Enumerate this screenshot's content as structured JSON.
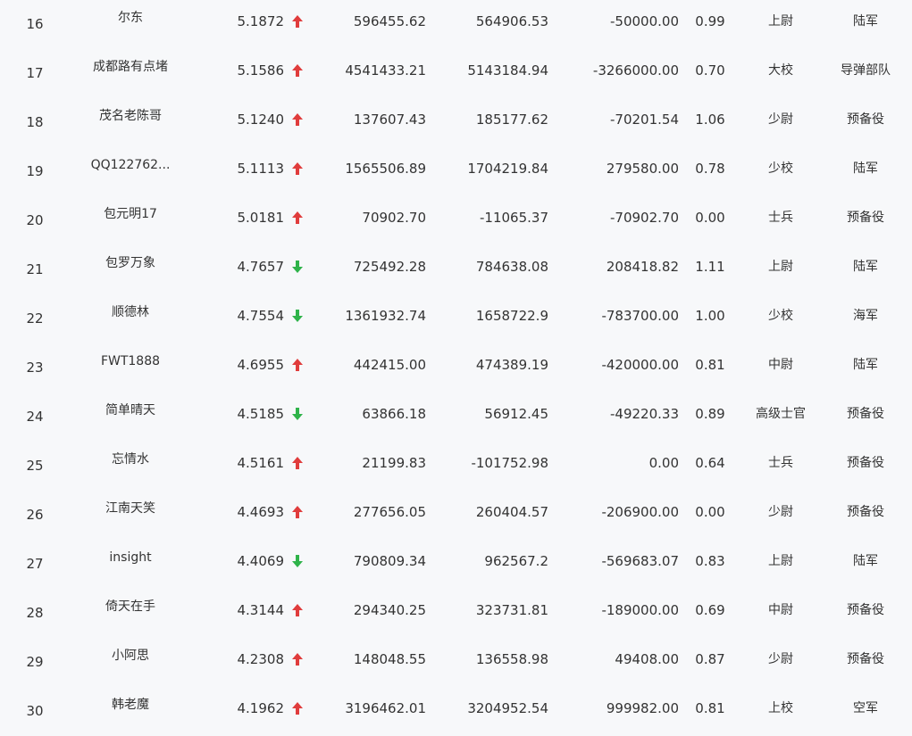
{
  "colors": {
    "up": "#e03c3c",
    "down": "#2fb34a",
    "text": "#333333",
    "background": "#f7f8fa"
  },
  "rows": [
    {
      "rank": "16",
      "name": "尔东",
      "score": "5.1872",
      "trend": "up",
      "v1": "596455.62",
      "v2": "564906.53",
      "v3": "-50000.00",
      "ratio": "0.99",
      "rank_title": "上尉",
      "branch": "陆军"
    },
    {
      "rank": "17",
      "name": "成都路有点堵",
      "score": "5.1586",
      "trend": "up",
      "v1": "4541433.21",
      "v2": "5143184.94",
      "v3": "-3266000.00",
      "ratio": "0.70",
      "rank_title": "大校",
      "branch": "导弹部队"
    },
    {
      "rank": "18",
      "name": "茂名老陈哥",
      "score": "5.1240",
      "trend": "up",
      "v1": "137607.43",
      "v2": "185177.62",
      "v3": "-70201.54",
      "ratio": "1.06",
      "rank_title": "少尉",
      "branch": "预备役"
    },
    {
      "rank": "19",
      "name": "QQ122762...",
      "score": "5.1113",
      "trend": "up",
      "v1": "1565506.89",
      "v2": "1704219.84",
      "v3": "279580.00",
      "ratio": "0.78",
      "rank_title": "少校",
      "branch": "陆军"
    },
    {
      "rank": "20",
      "name": "包元明17",
      "score": "5.0181",
      "trend": "up",
      "v1": "70902.70",
      "v2": "-11065.37",
      "v3": "-70902.70",
      "ratio": "0.00",
      "rank_title": "士兵",
      "branch": "预备役"
    },
    {
      "rank": "21",
      "name": "包罗万象",
      "score": "4.7657",
      "trend": "down",
      "v1": "725492.28",
      "v2": "784638.08",
      "v3": "208418.82",
      "ratio": "1.11",
      "rank_title": "上尉",
      "branch": "陆军"
    },
    {
      "rank": "22",
      "name": "顺德林",
      "score": "4.7554",
      "trend": "down",
      "v1": "1361932.74",
      "v2": "1658722.9",
      "v3": "-783700.00",
      "ratio": "1.00",
      "rank_title": "少校",
      "branch": "海军"
    },
    {
      "rank": "23",
      "name": "FWT1888",
      "score": "4.6955",
      "trend": "up",
      "v1": "442415.00",
      "v2": "474389.19",
      "v3": "-420000.00",
      "ratio": "0.81",
      "rank_title": "中尉",
      "branch": "陆军"
    },
    {
      "rank": "24",
      "name": "简单晴天",
      "score": "4.5185",
      "trend": "down",
      "v1": "63866.18",
      "v2": "56912.45",
      "v3": "-49220.33",
      "ratio": "0.89",
      "rank_title": "高级士官",
      "branch": "预备役"
    },
    {
      "rank": "25",
      "name": "忘情水",
      "score": "4.5161",
      "trend": "up",
      "v1": "21199.83",
      "v2": "-101752.98",
      "v3": "0.00",
      "ratio": "0.64",
      "rank_title": "士兵",
      "branch": "预备役"
    },
    {
      "rank": "26",
      "name": "江南天笑",
      "score": "4.4693",
      "trend": "up",
      "v1": "277656.05",
      "v2": "260404.57",
      "v3": "-206900.00",
      "ratio": "0.00",
      "rank_title": "少尉",
      "branch": "预备役"
    },
    {
      "rank": "27",
      "name": "insight",
      "score": "4.4069",
      "trend": "down",
      "v1": "790809.34",
      "v2": "962567.2",
      "v3": "-569683.07",
      "ratio": "0.83",
      "rank_title": "上尉",
      "branch": "陆军"
    },
    {
      "rank": "28",
      "name": "倚天在手",
      "score": "4.3144",
      "trend": "up",
      "v1": "294340.25",
      "v2": "323731.81",
      "v3": "-189000.00",
      "ratio": "0.69",
      "rank_title": "中尉",
      "branch": "预备役"
    },
    {
      "rank": "29",
      "name": "小阿思",
      "score": "4.2308",
      "trend": "up",
      "v1": "148048.55",
      "v2": "136558.98",
      "v3": "49408.00",
      "ratio": "0.87",
      "rank_title": "少尉",
      "branch": "预备役"
    },
    {
      "rank": "30",
      "name": "韩老魔",
      "score": "4.1962",
      "trend": "up",
      "v1": "3196462.01",
      "v2": "3204952.54",
      "v3": "999982.00",
      "ratio": "0.81",
      "rank_title": "上校",
      "branch": "空军"
    }
  ]
}
